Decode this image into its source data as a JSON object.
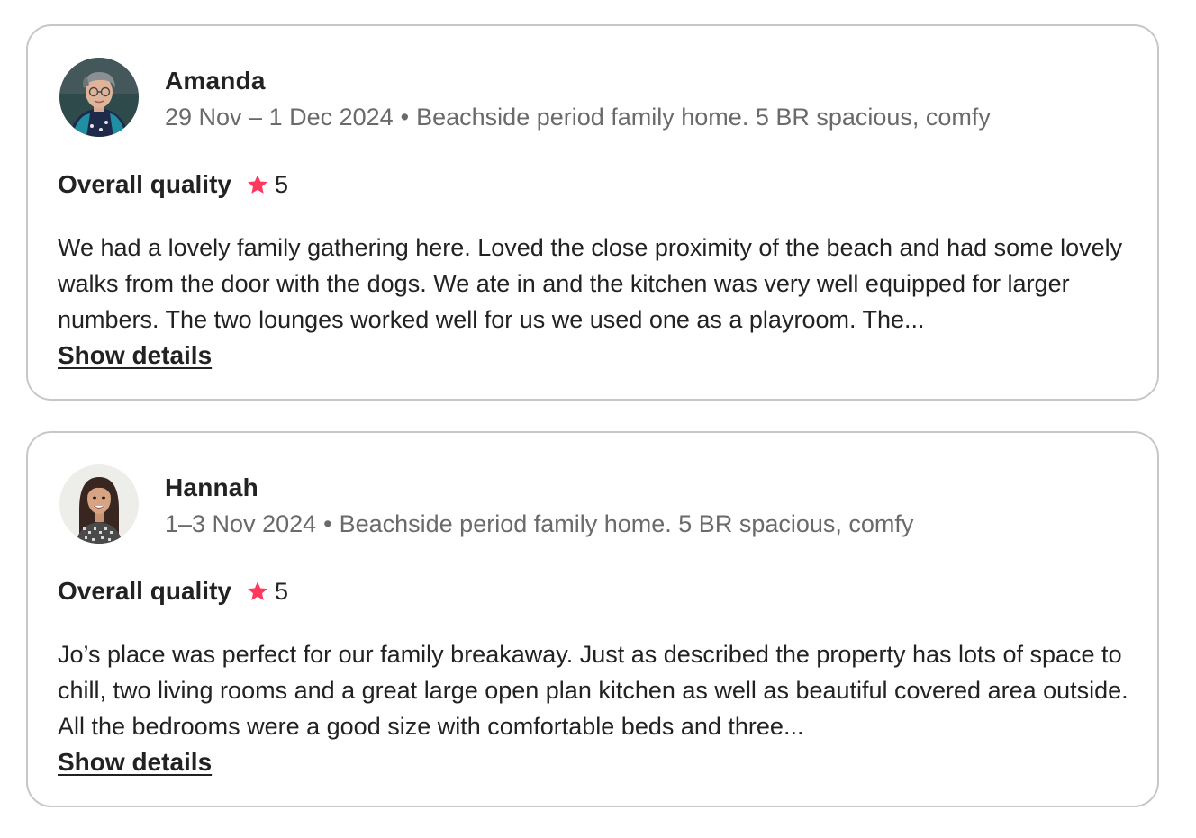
{
  "reviews": [
    {
      "name": "Amanda",
      "dates": "29 Nov – 1 Dec 2024",
      "separator": "•",
      "listing": "Beachside period family home. 5 BR spacious, comfy",
      "rating_label": "Overall quality",
      "rating_value": "5",
      "text": "We had a lovely family gathering here. Loved the close proximity of the beach and had some lovely walks from the door with the dogs. We ate in and the kitchen was very well equipped for larger numbers. The two lounges worked well for us we used one as a playroom. The...",
      "show_details_label": "Show details",
      "avatar_icon": "reviewer-photo"
    },
    {
      "name": "Hannah",
      "dates": "1–3 Nov 2024",
      "separator": "•",
      "listing": "Beachside period family home. 5 BR spacious, comfy",
      "rating_label": "Overall quality",
      "rating_value": "5",
      "text": "Jo’s place was perfect for our family breakaway. Just as described the property has lots of space to chill, two living rooms and a great large open plan kitchen as well as beautiful covered area outside. All the bedrooms were a good size with comfortable beds and three...",
      "show_details_label": "Show details",
      "avatar_icon": "reviewer-photo"
    }
  ],
  "colors": {
    "star": "#ff385c",
    "text": "#222222",
    "muted": "#6a6a6a",
    "border": "#c7c7c7"
  },
  "icons": {
    "star": "star-icon"
  }
}
